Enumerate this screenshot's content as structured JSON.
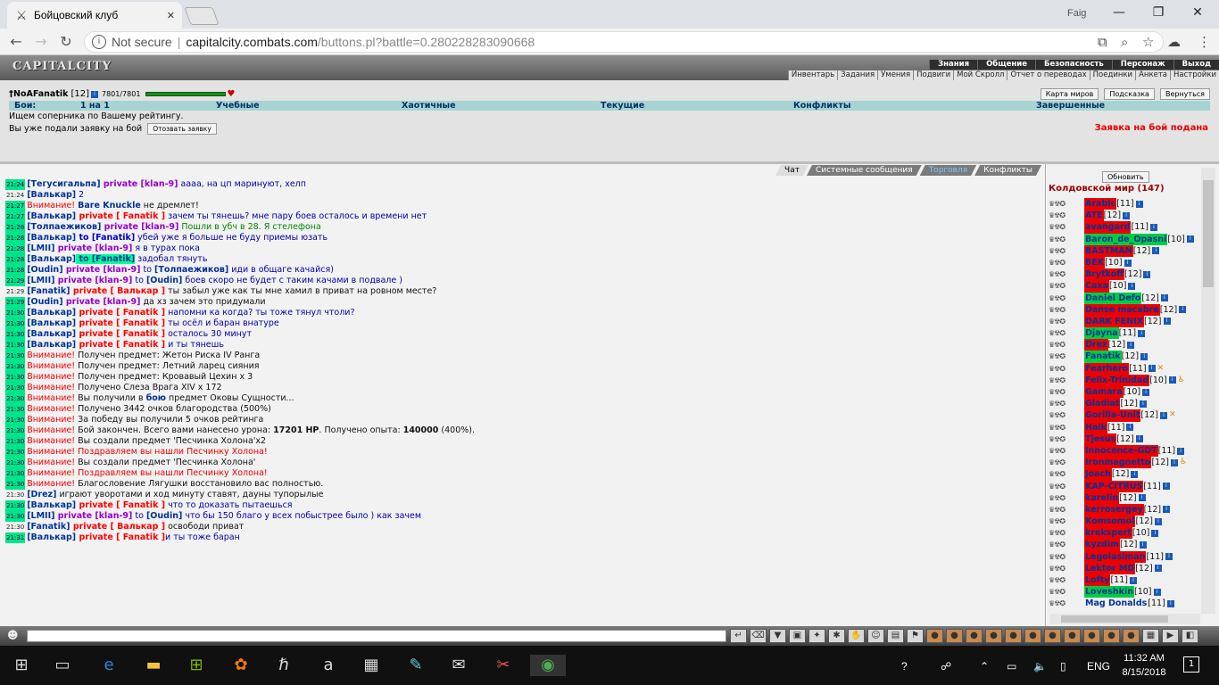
{
  "browser": {
    "tab_title": "Бойцовский клуб",
    "profile_name": "Faig",
    "not_secure": "Not secure",
    "url_host": "capitalcity.combats.com",
    "url_path": "/buttons.pl?battle=0.280228283090668"
  },
  "game": {
    "logo": "CAPITALCITY",
    "main_menu": [
      "Знания",
      "Общение",
      "Безопасность",
      "Персонаж",
      "Выход"
    ],
    "sub_menu": [
      "Инвентарь",
      "Задания",
      "Умения",
      "Подвиги",
      "Мой Скролл",
      "Отчет о переводах",
      "Поединки",
      "Анкета",
      "Настройки"
    ],
    "user": {
      "name": "NoAFanatik",
      "level": "[12]",
      "hp": "7801/7801",
      "hp_fraction": 1.0
    },
    "top_buttons": [
      "Карта миров",
      "Подсказка",
      "Вернуться"
    ],
    "battle_tabs": [
      "Бои:",
      "1 на 1",
      "Учебные",
      "Хаотичные",
      "Текущие",
      "Конфликты",
      "Завершенные"
    ],
    "status_line": "Ищем соперника по Вашему рейтингу.",
    "submitted_line": "Вы уже подали заявку на бой",
    "withdraw_button": "Отозвать заявку",
    "submitted_status": "Заявка на бой подана"
  },
  "chat": {
    "tabs": [
      "Чат",
      "Системные сообщения",
      "Торговля",
      "Конфликты"
    ],
    "lines": [
      {
        "t": "21:24",
        "hl": true,
        "p": [
          {
            "c": "nk",
            "x": "[Тегусигальпа]"
          },
          {
            "c": "pv",
            "x": " private [klan-9]"
          },
          {
            "c": "msg-blue",
            "x": " аааа, на цп маринуют, хелп"
          }
        ]
      },
      {
        "t": "21:24",
        "hl": false,
        "p": [
          {
            "c": "nk",
            "x": "[Валькар]"
          },
          {
            "c": "msg-blue",
            "x": " 2"
          }
        ]
      },
      {
        "t": "21:27",
        "hl": true,
        "p": [
          {
            "c": "at",
            "x": "Внимание!"
          },
          {
            "c": "msg-black",
            "x": " "
          },
          {
            "c": "nk",
            "x": "Bare Knuckle"
          },
          {
            "c": "msg-black",
            "x": " не дремлет!"
          }
        ]
      },
      {
        "t": "21:27",
        "hl": true,
        "p": [
          {
            "c": "nk",
            "x": "[Валькар]"
          },
          {
            "c": "pvr",
            "x": " private [ Fanatik ]"
          },
          {
            "c": "msg-blue",
            "x": " зачем ты тянешь? мне пару боев осталось и времени нет"
          }
        ]
      },
      {
        "t": "21:28",
        "hl": true,
        "p": [
          {
            "c": "nk",
            "x": "[Толпаежиков]"
          },
          {
            "c": "pv",
            "x": " private [klan-9]"
          },
          {
            "c": "msg-green",
            "x": " Пошли в убч в 28. Я стелефона"
          }
        ]
      },
      {
        "t": "21:28",
        "hl": true,
        "p": [
          {
            "c": "nk",
            "x": "[Валькар]"
          },
          {
            "c": "to",
            "x": " to [Fanatik]"
          },
          {
            "c": "msg-blue",
            "x": " убей уже я больше не буду приемы юзать"
          }
        ]
      },
      {
        "t": "21:28",
        "hl": true,
        "p": [
          {
            "c": "nk",
            "x": "[LMII]"
          },
          {
            "c": "pv",
            "x": " private [klan-9]"
          },
          {
            "c": "msg-blue",
            "x": " я в турах пока"
          }
        ]
      },
      {
        "t": "21:28",
        "hl": true,
        "p": [
          {
            "c": "nk",
            "x": "[Валькар]"
          },
          {
            "c": "toHL",
            "x": " to [Fanatik]"
          },
          {
            "c": "msg-blue",
            "x": " задобал тянуть"
          }
        ]
      },
      {
        "t": "21:28",
        "hl": true,
        "p": [
          {
            "c": "nk",
            "x": "[Oudin]"
          },
          {
            "c": "pv",
            "x": " private [klan-9]"
          },
          {
            "c": "msg-blue",
            "x": " to "
          },
          {
            "c": "nk",
            "x": "[Толпаежиков]"
          },
          {
            "c": "msg-blue",
            "x": " иди в общаге качайся)"
          }
        ]
      },
      {
        "t": "21:29",
        "hl": true,
        "p": [
          {
            "c": "nk",
            "x": "[LMII]"
          },
          {
            "c": "pv",
            "x": " private [klan-9]"
          },
          {
            "c": "msg-blue",
            "x": " to "
          },
          {
            "c": "nk",
            "x": "[Oudin]"
          },
          {
            "c": "msg-blue",
            "x": " боев скоро не будет с таким качами в подвале )"
          }
        ]
      },
      {
        "t": "21:29",
        "hl": false,
        "p": [
          {
            "c": "nk",
            "x": "[Fanatik]"
          },
          {
            "c": "pvr",
            "x": " private [ Валькар ]"
          },
          {
            "c": "msg-black",
            "x": " ты забыл уже как ты мне хамил в приват на ровном месте?"
          }
        ]
      },
      {
        "t": "21:29",
        "hl": true,
        "p": [
          {
            "c": "nk",
            "x": "[Oudin]"
          },
          {
            "c": "pv",
            "x": " private [klan-9]"
          },
          {
            "c": "msg-black",
            "x": " да хз зачем это придумали"
          }
        ]
      },
      {
        "t": "21:30",
        "hl": true,
        "p": [
          {
            "c": "nk",
            "x": "[Валькар]"
          },
          {
            "c": "pvr",
            "x": " private [ Fanatik ]"
          },
          {
            "c": "msg-blue",
            "x": " напомни ка когда? ты тоже тянул чтоли?"
          }
        ]
      },
      {
        "t": "21:30",
        "hl": true,
        "p": [
          {
            "c": "nk",
            "x": "[Валькар]"
          },
          {
            "c": "pvr",
            "x": " private [ Fanatik ]"
          },
          {
            "c": "msg-blue",
            "x": " ты осёл и баран внатуре"
          }
        ]
      },
      {
        "t": "21:30",
        "hl": true,
        "p": [
          {
            "c": "nk",
            "x": "[Валькар]"
          },
          {
            "c": "pvr",
            "x": " private [ Fanatik ]"
          },
          {
            "c": "msg-blue",
            "x": " осталось 30 минут"
          }
        ]
      },
      {
        "t": "21:30",
        "hl": true,
        "p": [
          {
            "c": "nk",
            "x": "[Валькар]"
          },
          {
            "c": "pvr",
            "x": " private [ Fanatik ]"
          },
          {
            "c": "msg-blue",
            "x": " и ты тянешь"
          }
        ]
      },
      {
        "t": "21:30",
        "hl": true,
        "p": [
          {
            "c": "at",
            "x": "Внимание!"
          },
          {
            "c": "msg-black",
            "x": " Получен предмет: Жетон Риска IV Ранга"
          }
        ]
      },
      {
        "t": "21:30",
        "hl": true,
        "p": [
          {
            "c": "at",
            "x": "Внимание!"
          },
          {
            "c": "msg-black",
            "x": " Получен предмет: Летний ларец сияния"
          }
        ]
      },
      {
        "t": "21:30",
        "hl": true,
        "p": [
          {
            "c": "at",
            "x": "Внимание!"
          },
          {
            "c": "msg-black",
            "x": " Получен предмет: Кровавый Цехин x 3"
          }
        ]
      },
      {
        "t": "21:30",
        "hl": true,
        "p": [
          {
            "c": "at",
            "x": "Внимание!"
          },
          {
            "c": "msg-black",
            "x": " Получено Слеза Врага XIV x 172"
          }
        ]
      },
      {
        "t": "21:30",
        "hl": true,
        "p": [
          {
            "c": "at",
            "x": "Внимание!"
          },
          {
            "c": "msg-black",
            "x": " Вы получили в "
          },
          {
            "c": "nk",
            "x": "бою"
          },
          {
            "c": "msg-black",
            "x": " предмет Оковы Сущности..."
          }
        ]
      },
      {
        "t": "21:30",
        "hl": true,
        "p": [
          {
            "c": "at",
            "x": "Внимание!"
          },
          {
            "c": "msg-black",
            "x": " Получено 3442 очков благородства (500%)"
          }
        ]
      },
      {
        "t": "21:30",
        "hl": true,
        "p": [
          {
            "c": "at",
            "x": "Внимание!"
          },
          {
            "c": "msg-black",
            "x": " За победу вы получили 5 очков рейтинга"
          }
        ]
      },
      {
        "t": "21:30",
        "hl": true,
        "p": [
          {
            "c": "at",
            "x": "Внимание!"
          },
          {
            "c": "msg-black",
            "x": " Бой закончен. Всего вами нанесено урона: "
          },
          {
            "c": "nkb",
            "x": "17201 HP"
          },
          {
            "c": "msg-black",
            "x": ". Получено опыта: "
          },
          {
            "c": "nkb",
            "x": "140000"
          },
          {
            "c": "msg-black",
            "x": " (400%)."
          }
        ]
      },
      {
        "t": "21:30",
        "hl": true,
        "p": [
          {
            "c": "at",
            "x": "Внимание!"
          },
          {
            "c": "msg-black",
            "x": " Вы создали предмет 'Песчинка Холона'x2"
          }
        ]
      },
      {
        "t": "21:30",
        "hl": true,
        "p": [
          {
            "c": "at",
            "x": "Внимание!"
          },
          {
            "c": "msg-red",
            "x": " Поздравляем вы нашли Песчинку Холона!"
          }
        ]
      },
      {
        "t": "21:30",
        "hl": true,
        "p": [
          {
            "c": "at",
            "x": "Внимание!"
          },
          {
            "c": "msg-black",
            "x": " Вы создали предмет 'Песчинка Холона'"
          }
        ]
      },
      {
        "t": "21:30",
        "hl": true,
        "p": [
          {
            "c": "at",
            "x": "Внимание!"
          },
          {
            "c": "msg-red",
            "x": " Поздравляем вы нашли Песчинку Холона!"
          }
        ]
      },
      {
        "t": "21:30",
        "hl": true,
        "p": [
          {
            "c": "at",
            "x": "Внимание!"
          },
          {
            "c": "msg-black",
            "x": " Благословение Лягушки восстановило вас полностью."
          }
        ]
      },
      {
        "t": "21:30",
        "hl": false,
        "p": [
          {
            "c": "nk",
            "x": "[Drez]"
          },
          {
            "c": "msg-black",
            "x": " играют уворотами и ход минуту ставят, дауны тупорылые"
          }
        ]
      },
      {
        "t": "21:30",
        "hl": true,
        "p": [
          {
            "c": "nk",
            "x": "[Валькар]"
          },
          {
            "c": "pvr",
            "x": " private [ Fanatik ]"
          },
          {
            "c": "msg-blue",
            "x": " что то доказать пытаешься"
          }
        ]
      },
      {
        "t": "21:30",
        "hl": true,
        "p": [
          {
            "c": "nk",
            "x": "[LMII]"
          },
          {
            "c": "pv",
            "x": " private [klan-9]"
          },
          {
            "c": "msg-blue",
            "x": " to "
          },
          {
            "c": "nk",
            "x": "[Oudin]"
          },
          {
            "c": "msg-blue",
            "x": " что бы 150 благо у всех побыстрее было ) как зачем"
          }
        ]
      },
      {
        "t": "21:30",
        "hl": false,
        "p": [
          {
            "c": "nk",
            "x": "[Fanatik]"
          },
          {
            "c": "pvr",
            "x": " private [ Валькар ]"
          },
          {
            "c": "msg-black",
            "x": " освободи приват"
          }
        ]
      },
      {
        "t": "21:31",
        "hl": true,
        "p": [
          {
            "c": "nk",
            "x": "[Валькар]"
          },
          {
            "c": "pvr",
            "x": " private [ Fanatik ]"
          },
          {
            "c": "msg-blue",
            "x": "и ты тоже баран"
          }
        ]
      }
    ]
  },
  "online": {
    "refresh_button": "Обновить",
    "world_title": "Колдовской мир (147)",
    "users": [
      {
        "n": "Arabic",
        "l": "[11]",
        "bg": "red"
      },
      {
        "n": "ATE",
        "l": "[12]",
        "bg": "red"
      },
      {
        "n": "avangard",
        "l": "[11]",
        "bg": "red"
      },
      {
        "n": "Baron_de_Opasni",
        "l": "[10]",
        "bg": "green"
      },
      {
        "n": "BASTMAN",
        "l": "[12]",
        "bg": "red"
      },
      {
        "n": "BEK",
        "l": "[10]",
        "bg": "red"
      },
      {
        "n": "Brytkoff",
        "l": "[12]",
        "bg": "red"
      },
      {
        "n": "Caxa",
        "l": "[10]",
        "bg": "red"
      },
      {
        "n": "Daniel Defo",
        "l": "[12]",
        "bg": "green"
      },
      {
        "n": "Danse macabre",
        "l": "[12]",
        "bg": "red"
      },
      {
        "n": "DARK FENIX",
        "l": "[12]",
        "bg": "red"
      },
      {
        "n": "Djayna",
        "l": "[11]",
        "bg": "green"
      },
      {
        "n": "Drez",
        "l": "[12]",
        "bg": "red"
      },
      {
        "n": "Fanatik",
        "l": "[12]",
        "bg": "green"
      },
      {
        "n": "Fearhero",
        "l": "[11]",
        "bg": "red",
        "extra": "✕"
      },
      {
        "n": "Felix-Trinidad",
        "l": "[10]",
        "bg": "red",
        "extra": "♿"
      },
      {
        "n": "Gamara",
        "l": "[10]",
        "bg": "red"
      },
      {
        "n": "Gladiat",
        "l": "[12]",
        "bg": "red"
      },
      {
        "n": "Gorilla-Unit",
        "l": "[12]",
        "bg": "red",
        "extra": "✕"
      },
      {
        "n": "Haik",
        "l": "[11]",
        "bg": "red"
      },
      {
        "n": "Tjesus",
        "l": "[12]",
        "bg": "red"
      },
      {
        "n": "Innocence-GDT",
        "l": "[11]",
        "bg": "red"
      },
      {
        "n": "Ironmagnetto",
        "l": "[12]",
        "bg": "red",
        "extra": "♿"
      },
      {
        "n": "Joach",
        "l": "[12]",
        "bg": "red"
      },
      {
        "n": "KAP-CITRUS",
        "l": "[11]",
        "bg": "red"
      },
      {
        "n": "karelin",
        "l": "[12]",
        "bg": "red"
      },
      {
        "n": "kerrosergey",
        "l": "[12]",
        "bg": "red"
      },
      {
        "n": "Komsomol",
        "l": "[12]",
        "bg": "red"
      },
      {
        "n": "krekspert",
        "l": "[10]",
        "bg": "red"
      },
      {
        "n": "kyzdim",
        "l": "[12]",
        "bg": "red"
      },
      {
        "n": "Legolasiman",
        "l": "[11]",
        "bg": "red"
      },
      {
        "n": "Lektor MD",
        "l": "[12]",
        "bg": "red"
      },
      {
        "n": "Lofty",
        "l": "[11]",
        "bg": "red"
      },
      {
        "n": "Loveshkin",
        "l": "[10]",
        "bg": "green"
      },
      {
        "n": "Mag Donalds",
        "l": "[11]",
        "bg": "plain"
      }
    ]
  },
  "taskbar": {
    "time": "11:32 AM",
    "date": "8/15/2018",
    "lang": "ENG",
    "notif_count": "1"
  }
}
